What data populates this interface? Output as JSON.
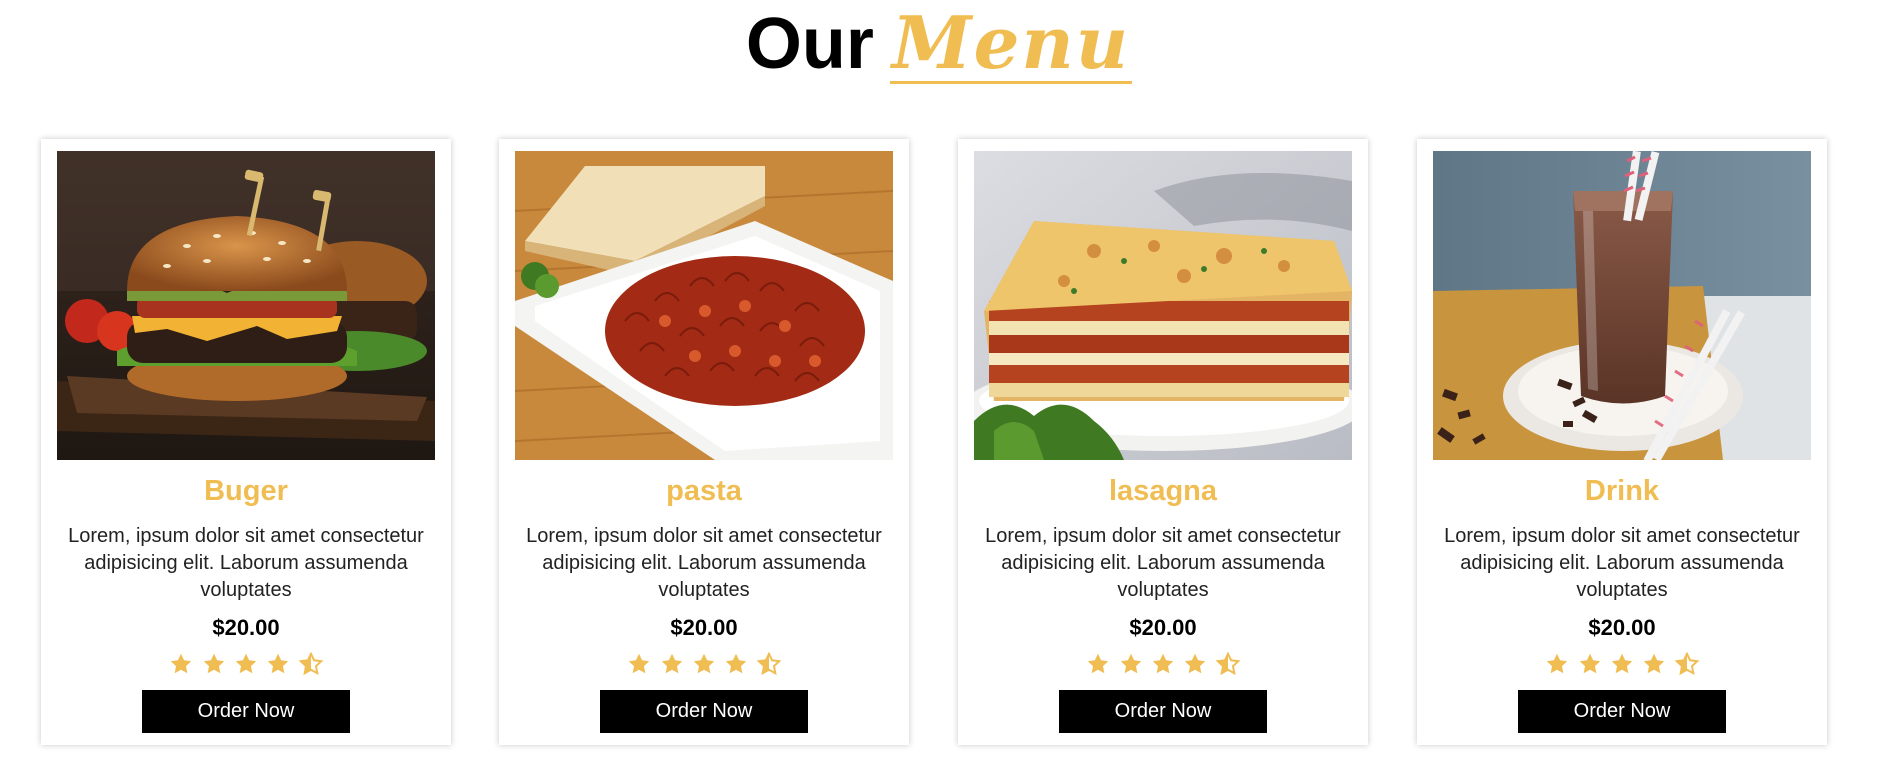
{
  "heading": {
    "prefix": "Our",
    "accent": "Menu",
    "accent_color": "#f0bd52"
  },
  "cards": [
    {
      "title": "Buger",
      "description": "Lorem, ipsum dolor sit amet consectetur adipisicing elit. Laborum assumenda voluptates",
      "price": "$20.00",
      "rating": 4.5,
      "button_label": "Order Now",
      "image": "burger-image"
    },
    {
      "title": "pasta",
      "description": "Lorem, ipsum dolor sit amet consectetur adipisicing elit. Laborum assumenda voluptates",
      "price": "$20.00",
      "rating": 4.5,
      "button_label": "Order Now",
      "image": "pasta-image"
    },
    {
      "title": "lasagna",
      "description": "Lorem, ipsum dolor sit amet consectetur adipisicing elit. Laborum assumenda voluptates",
      "price": "$20.00",
      "rating": 4.5,
      "button_label": "Order Now",
      "image": "lasagna-image"
    },
    {
      "title": "Drink",
      "description": "Lorem, ipsum dolor sit amet consectetur adipisicing elit. Laborum assumenda voluptates",
      "price": "$20.00",
      "rating": 4.5,
      "button_label": "Order Now",
      "image": "drink-image"
    }
  ],
  "colors": {
    "accent": "#f0bd52",
    "button_bg": "#000000",
    "button_text": "#ffffff"
  }
}
